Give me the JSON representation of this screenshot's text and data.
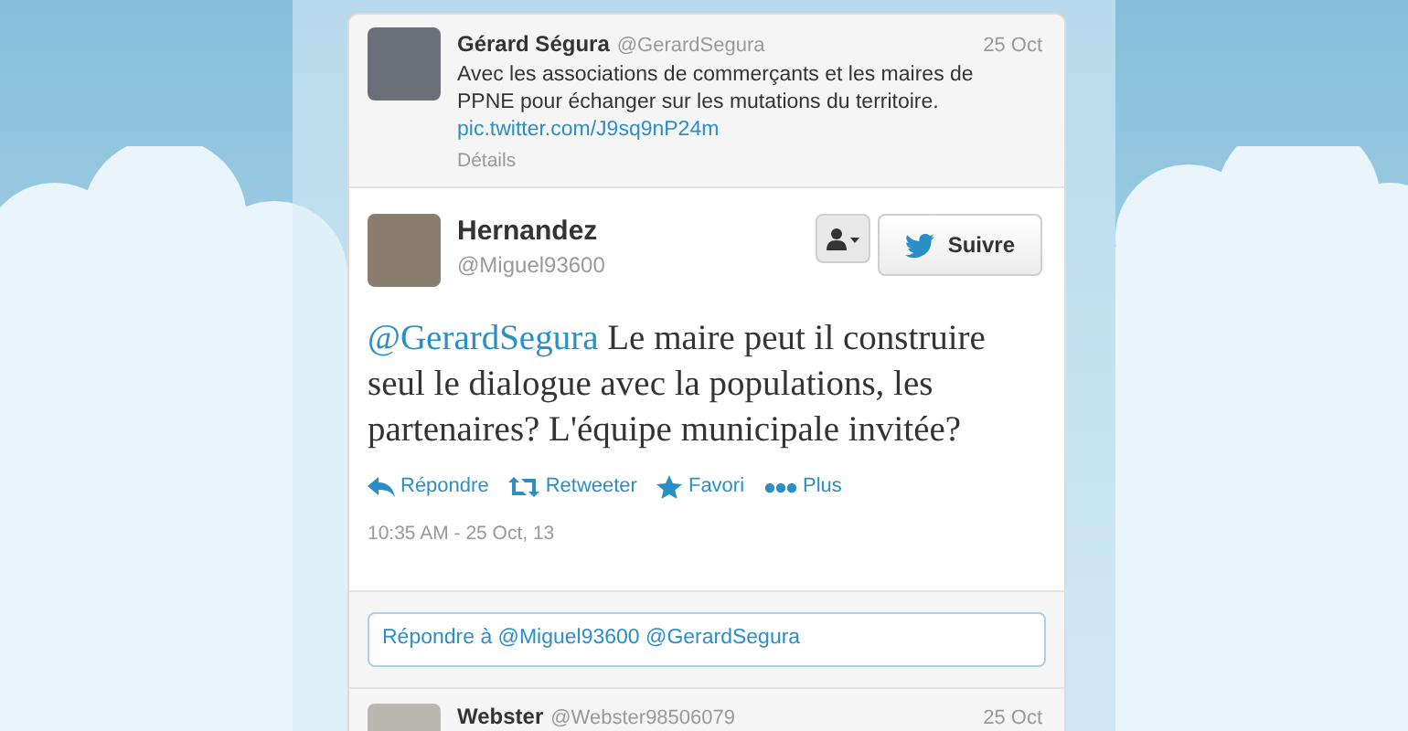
{
  "previous_tweet": {
    "name": "Gérard Ségura",
    "handle": "@GerardSegura",
    "date": "25 Oct",
    "text": "Avec les associations de commerçants et les maires de PPNE pour échanger sur les mutations du territoire.",
    "link": "pic.twitter.com/J9sq9nP24m",
    "details": "Détails"
  },
  "tweet": {
    "name": "Hernandez",
    "handle": "@Miguel93600",
    "follow_button": "Suivre",
    "mention": "@GerardSegura",
    "text": "Le maire peut il construire seul le dialogue avec la populations, les partenaires? L'équipe municipale invitée?",
    "actions": [
      {
        "kind": "reply",
        "label": "Répondre"
      },
      {
        "kind": "retweet",
        "label": "Retweeter"
      },
      {
        "kind": "favorite",
        "label": "Favori"
      },
      {
        "kind": "more",
        "label": "Plus"
      }
    ],
    "timestamp": "10:35 AM - 25 Oct, 13"
  },
  "reply_box": {
    "value": "Répondre à @Miguel93600 @GerardSegura"
  },
  "next_tweet": {
    "name": "Webster",
    "handle": "@Webster98506079",
    "date": "25 Oct"
  }
}
